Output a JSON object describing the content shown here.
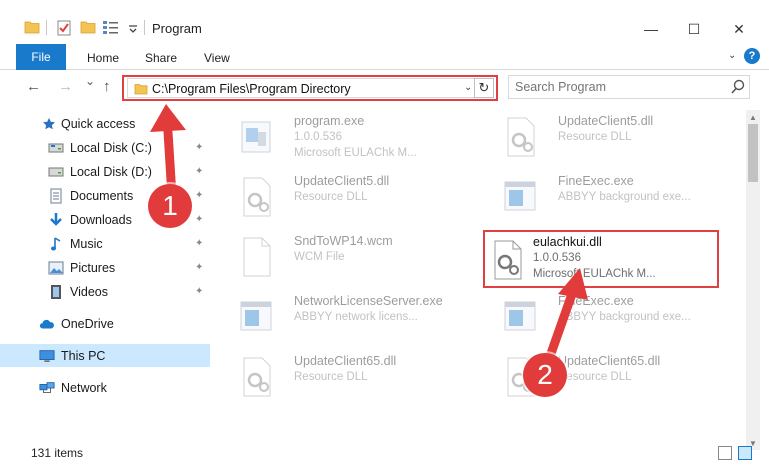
{
  "window": {
    "title": "Program",
    "minimize_glyph": "—",
    "maximize_glyph": "☐",
    "close_glyph": "✕"
  },
  "ribbon": {
    "tabs": [
      {
        "label": "File"
      },
      {
        "label": "Home"
      },
      {
        "label": "Share"
      },
      {
        "label": "View"
      }
    ],
    "help_glyph": "?"
  },
  "nav": {
    "back_glyph": "←",
    "forward_glyph": "→",
    "recent_glyph": "⌄",
    "up_glyph": "↑"
  },
  "address": {
    "path": "C:\\Program Files\\Program Directory",
    "refresh_glyph": "↻"
  },
  "search": {
    "placeholder": "Search Program"
  },
  "sidebar": {
    "items": [
      {
        "label": "Quick access",
        "icon": "star-icon",
        "pinned": false
      },
      {
        "label": "Local Disk (C:)",
        "icon": "drive-icon",
        "pinned": true
      },
      {
        "label": "Local Disk (D:)",
        "icon": "drive-icon",
        "pinned": true
      },
      {
        "label": "Documents",
        "icon": "documents-icon",
        "pinned": true
      },
      {
        "label": "Downloads",
        "icon": "download-icon",
        "pinned": true
      },
      {
        "label": "Music",
        "icon": "music-icon",
        "pinned": true
      },
      {
        "label": "Pictures",
        "icon": "pictures-icon",
        "pinned": true
      },
      {
        "label": "Videos",
        "icon": "videos-icon",
        "pinned": true
      },
      {
        "label": "OneDrive",
        "icon": "cloud-icon",
        "pinned": false
      },
      {
        "label": "This PC",
        "icon": "computer-icon",
        "pinned": false,
        "selected": true
      },
      {
        "label": "Network",
        "icon": "network-icon",
        "pinned": false
      }
    ],
    "pin_glyph": "📌"
  },
  "files": [
    {
      "name": "program.exe",
      "line1": "1.0.0.536",
      "line2": "Microsoft EULAChk M...",
      "icon": "exe-icon"
    },
    {
      "name": "UpdateClient5.dll",
      "line1": "Resource DLL",
      "line2": "",
      "icon": "dll-icon"
    },
    {
      "name": "UpdateClient5.dll",
      "line1": "Resource DLL",
      "line2": "",
      "icon": "dll-icon"
    },
    {
      "name": "FineExec.exe",
      "line1": "ABBYY background exe...",
      "line2": "",
      "icon": "app-icon"
    },
    {
      "name": "SndToWP14.wcm",
      "line1": "WCM File",
      "line2": "",
      "icon": "file-icon"
    },
    {
      "name": "NetworkLicenseServer.exe",
      "line1": "ABBYY network licens...",
      "line2": "",
      "icon": "app-icon"
    },
    {
      "name": "FineExec.exe",
      "line1": "ABBYY background exe...",
      "line2": "",
      "icon": "app-icon"
    },
    {
      "name": "UpdateClient65.dll",
      "line1": "Resource DLL",
      "line2": "",
      "icon": "dll-icon"
    },
    {
      "name": "UpdateClient65.dll",
      "line1": "Resource DLL",
      "line2": "",
      "icon": "dll-icon"
    }
  ],
  "highlighted_file": {
    "name": "eulachkui.dll",
    "line1": "1.0.0.536",
    "line2": "Microsoft EULAChk M..."
  },
  "status": {
    "item_count": "131 items"
  },
  "annotations": [
    {
      "label": "1"
    },
    {
      "label": "2"
    }
  ],
  "colors": {
    "accent": "#1979ca",
    "highlight": "#e04040",
    "callout": "#e23b3b",
    "selected": "#cce8ff",
    "folder": "#f3c451"
  }
}
